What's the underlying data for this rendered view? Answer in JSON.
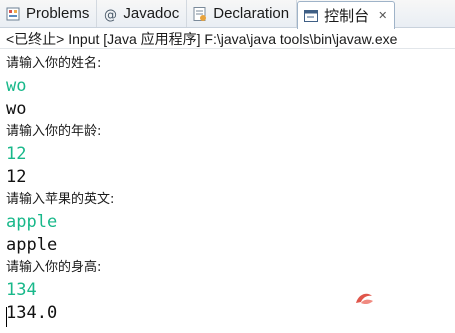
{
  "tabs": [
    {
      "label": "Problems",
      "icon": "problems-icon"
    },
    {
      "label": "Javadoc",
      "icon": "at-icon"
    },
    {
      "label": "Declaration",
      "icon": "declaration-icon"
    },
    {
      "label": "控制台",
      "icon": "console-icon"
    }
  ],
  "close_glyph": "✕",
  "console": {
    "header": "<已终止> Input [Java 应用程序] F:\\java\\java tools\\bin\\javaw.exe",
    "lines": [
      {
        "kind": "prompt",
        "text": "请输入你的姓名:"
      },
      {
        "kind": "input",
        "text": "wo"
      },
      {
        "kind": "output",
        "text": "wo"
      },
      {
        "kind": "prompt",
        "text": "请输入你的年龄:"
      },
      {
        "kind": "input",
        "text": "12"
      },
      {
        "kind": "output",
        "text": "12"
      },
      {
        "kind": "prompt",
        "text": "请输入苹果的英文:"
      },
      {
        "kind": "input",
        "text": "apple"
      },
      {
        "kind": "output",
        "text": "apple"
      },
      {
        "kind": "prompt",
        "text": "请输入你的身高:"
      },
      {
        "kind": "input",
        "text": "134"
      },
      {
        "kind": "output",
        "text": "134.0"
      }
    ]
  },
  "colors": {
    "input_echo": "#18b88a",
    "accent": "#9fb3c8",
    "watermark": "#e0564b"
  },
  "watermark_icon": "logo-watermark-icon"
}
